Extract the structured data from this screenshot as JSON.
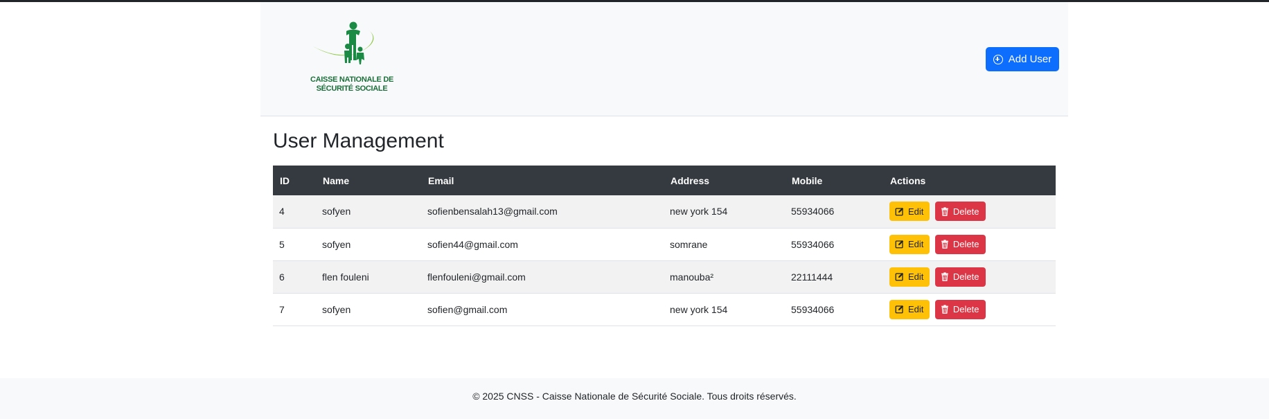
{
  "header": {
    "logo_text_line1": "CAISSE NATIONALE DE",
    "logo_text_line2": "SÉCURITÉ SOCIALE",
    "add_user_label": "Add User"
  },
  "main": {
    "title": "User Management",
    "table": {
      "columns": [
        "ID",
        "Name",
        "Email",
        "Address",
        "Mobile",
        "Actions"
      ],
      "rows": [
        {
          "id": "4",
          "name": "sofyen",
          "email": "sofienbensalah13@gmail.com",
          "address": "new york 154",
          "mobile": "55934066"
        },
        {
          "id": "5",
          "name": "sofyen",
          "email": "sofien44@gmail.com",
          "address": "somrane",
          "mobile": "55934066"
        },
        {
          "id": "6",
          "name": "flen fouleni",
          "email": "flenfouleni@gmail.com",
          "address": "manouba²",
          "mobile": "22111444"
        },
        {
          "id": "7",
          "name": "sofyen",
          "email": "sofien@gmail.com",
          "address": "new york 154",
          "mobile": "55934066"
        }
      ],
      "edit_label": "Edit",
      "delete_label": "Delete"
    }
  },
  "footer": {
    "text": "© 2025 CNSS - Caisse Nationale de Sécurité Sociale. Tous droits réservés."
  },
  "colors": {
    "primary": "#0d6efd",
    "warning": "#ffc107",
    "danger": "#dc3545",
    "table_header": "#343a40",
    "logo_green": "#1b6e3a"
  }
}
